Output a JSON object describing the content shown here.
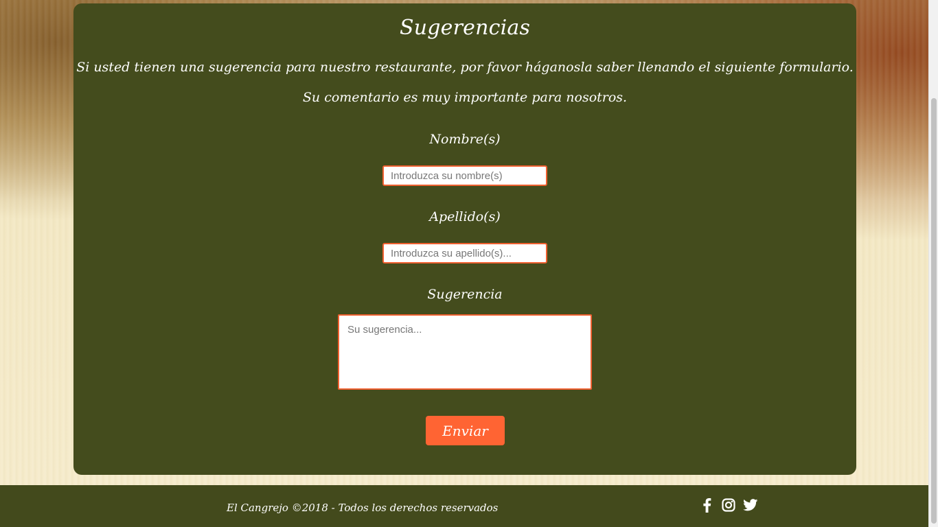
{
  "form": {
    "title": "Sugerencias",
    "intro_line_1": "Si usted tienen una sugerencia para nuestro restaurante, por favor háganosla saber llenando el siguiente formulario.",
    "intro_line_2": "Su comentario es muy importante para nosotros.",
    "nombre_label": "Nombre(s)",
    "nombre_placeholder": "Introduzca su nombre(s)",
    "apellido_label": "Apellido(s)",
    "apellido_placeholder": "Introduzca su apellido(s)...",
    "sugerencia_label": "Sugerencia",
    "sugerencia_placeholder": "Su sugerencia...",
    "submit_label": "Enviar"
  },
  "footer": {
    "copyright": "El Cangrejo ©2018 - Todos los derechos reservados",
    "social_icons": [
      "facebook-icon",
      "instagram-icon",
      "twitter-icon"
    ]
  },
  "colors": {
    "panel": "#444c1d",
    "accent": "#ff6433",
    "footer": "#434a1c"
  }
}
